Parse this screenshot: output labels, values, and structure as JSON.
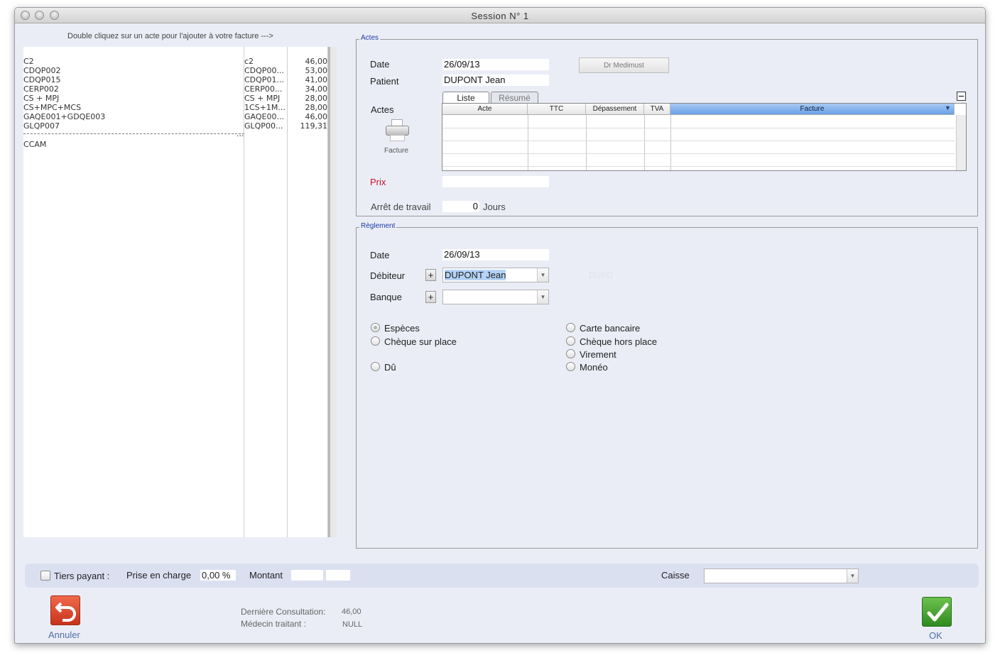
{
  "window": {
    "title": "Session N° 1"
  },
  "left_panel": {
    "hint": "Double cliquez sur un acte pour l'ajouter à votre facture --->",
    "rows": [
      {
        "name": "C2",
        "code": "c2",
        "price": "46,00"
      },
      {
        "name": "CDQP002",
        "code": "CDQP00...",
        "price": "53,00"
      },
      {
        "name": "CDQP015",
        "code": "CDQP01...",
        "price": "41,00"
      },
      {
        "name": "CERP002",
        "code": "CERP00...",
        "price": "34,00"
      },
      {
        "name": "CS + MPJ",
        "code": "CS + MPJ",
        "price": "28,00"
      },
      {
        "name": "CS+MPC+MCS",
        "code": "1CS+1M...",
        "price": "28,00"
      },
      {
        "name": "GAQE001+GDQE003",
        "code": "GAQE00...",
        "price": "46,00"
      },
      {
        "name": "GLQP007",
        "code": "GLQP00...",
        "price": "119,31"
      }
    ],
    "separator_dots": "...",
    "footer_item": "CCAM"
  },
  "actes": {
    "legend": "Actes",
    "date_label": "Date",
    "date_value": "26/09/13",
    "patient_label": "Patient",
    "patient_value": "DUPONT  Jean",
    "doctor_button": "Dr Medimust",
    "actes_label": "Actes",
    "print_label": "Facture",
    "tabs": [
      "Liste",
      "Résumé"
    ],
    "columns": [
      "Acte",
      "TTC",
      "Dépassement",
      "TVA",
      "Facture"
    ],
    "sort_indicator": "▼",
    "prix_label": "Prix",
    "arret_label": "Arrêt de travail",
    "arret_value": "0",
    "arret_unit": "Jours"
  },
  "reglement": {
    "legend": "Règlement",
    "date_label": "Date",
    "date_value": "26/09/13",
    "debiteur_label": "Débiteur",
    "debiteur_value": "DUPONT  Jean",
    "debiteur_ghost": "DUPO",
    "banque_label": "Banque",
    "banque_value": "",
    "add_symbol": "+",
    "payment_methods": {
      "especes": "Espèces",
      "cheque_place": "Chèque sur place",
      "du": "Dû",
      "carte": "Carte bancaire",
      "cheque_hors": "Chèque hors place",
      "virement": "Virement",
      "moneo": "Monéo"
    },
    "selected": "especes"
  },
  "footer": {
    "tiers_label": "Tiers payant :",
    "prise_label": "Prise en charge",
    "prise_value": "0,00 %",
    "montant_label": "Montant",
    "caisse_label": "Caisse",
    "caisse_value": ""
  },
  "bottom": {
    "cancel_label": "Annuler",
    "ok_label": "OK",
    "derniere_label": "Dernière Consultation:",
    "derniere_value": "46,00",
    "medecin_label": "Médecin traitant :",
    "medecin_value": "NULL"
  },
  "colors": {
    "legend_blue": "#1a3aa8",
    "prix_red": "#c8102e",
    "window_bg": "#ebedf6",
    "selected_header": "#6aa0e6",
    "ok_green": "#3c9a2a",
    "cancel_red": "#d9412a"
  }
}
